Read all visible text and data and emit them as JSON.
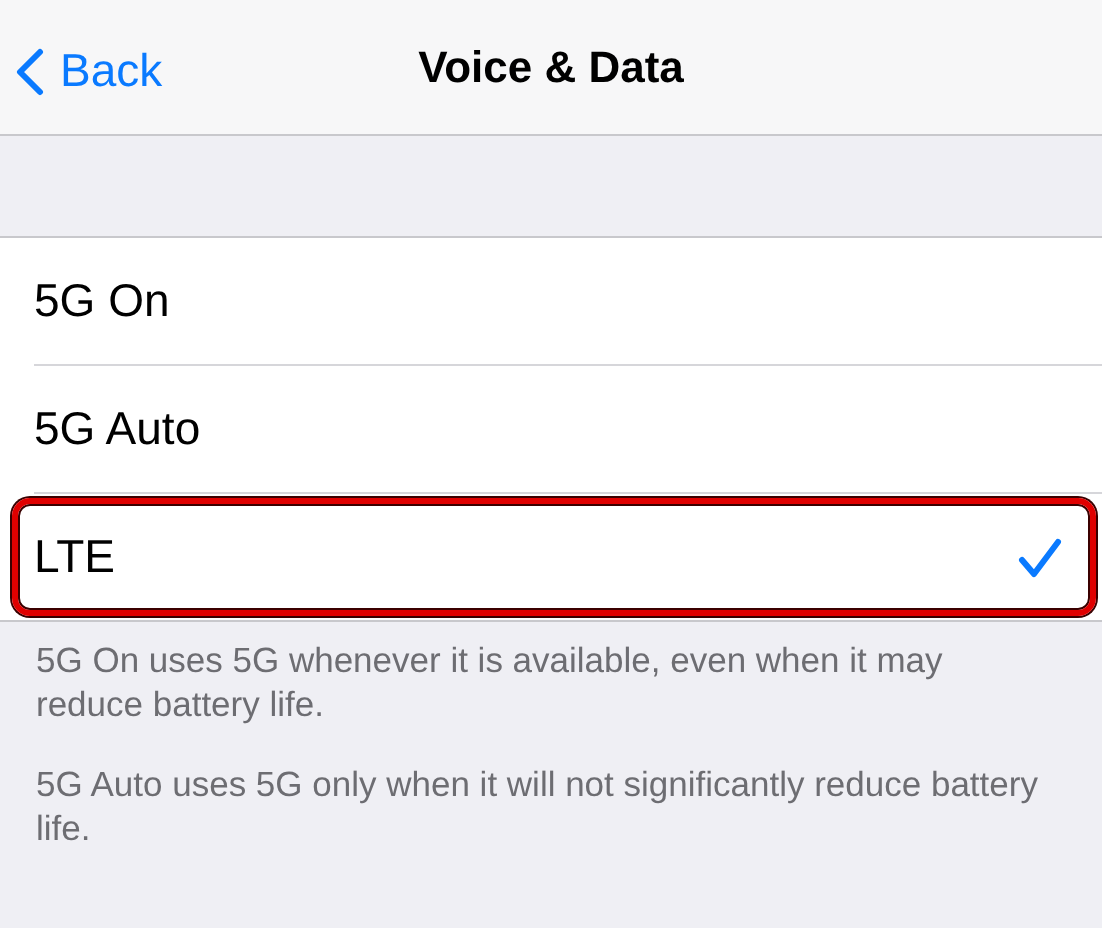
{
  "nav": {
    "back": "Back",
    "title": "Voice & Data"
  },
  "options": [
    {
      "label": "5G On",
      "selected": false,
      "highlighted": false
    },
    {
      "label": "5G Auto",
      "selected": false,
      "highlighted": false
    },
    {
      "label": "LTE",
      "selected": true,
      "highlighted": true
    }
  ],
  "notes": [
    "5G On uses 5G whenever it is available, even when it may reduce battery life.",
    "5G Auto uses 5G only when it will not significantly reduce battery life."
  ]
}
